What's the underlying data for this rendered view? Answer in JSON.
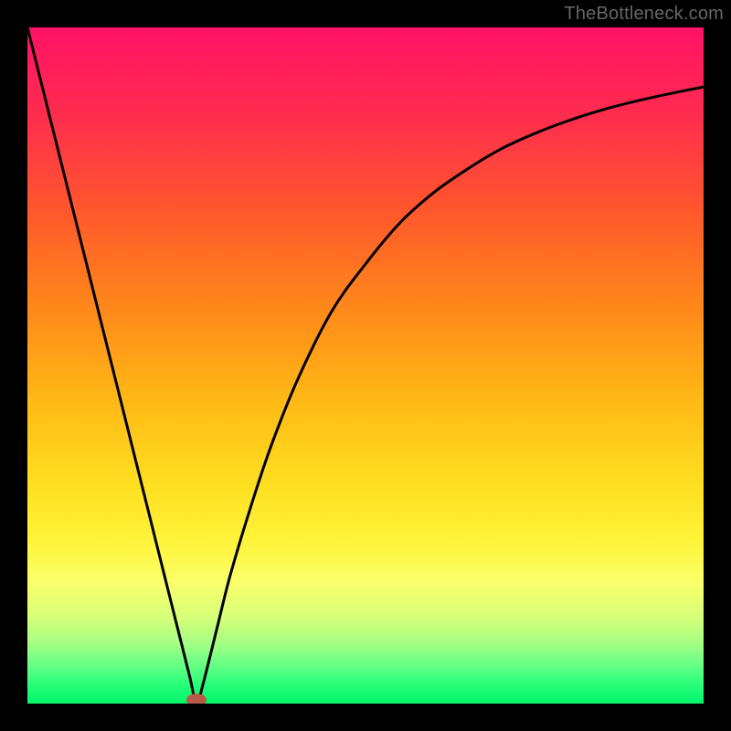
{
  "watermark": {
    "text": "TheBottleneck.com"
  },
  "chart_data": {
    "type": "line",
    "title": "",
    "xlabel": "",
    "ylabel": "",
    "xlim": [
      0,
      100
    ],
    "ylim": [
      0,
      100
    ],
    "grid": false,
    "legend": false,
    "series": [
      {
        "name": "curve",
        "x": [
          0,
          2,
          4,
          6,
          8,
          10,
          12,
          14,
          16,
          18,
          20,
          22,
          24,
          25,
          26,
          28,
          30,
          33,
          36,
          40,
          45,
          50,
          55,
          60,
          65,
          70,
          75,
          80,
          85,
          90,
          95,
          100
        ],
        "y": [
          100,
          92,
          84,
          76,
          68,
          60,
          52,
          44,
          36,
          28,
          20,
          12,
          4,
          0,
          3,
          11,
          19,
          29,
          38,
          48,
          58,
          65,
          71,
          75.5,
          79,
          82,
          84.3,
          86.2,
          87.8,
          89.1,
          90.2,
          91.2
        ]
      }
    ],
    "marker": {
      "x": 25,
      "y": 0,
      "color": "#b85a4a"
    },
    "background_gradient": [
      "#ff1265",
      "#ff2a50",
      "#ff5a2a",
      "#ff8a1a",
      "#ffb815",
      "#ffe022",
      "#fff43a",
      "#fbff6a",
      "#d8ff78",
      "#a6ff83",
      "#6cff86",
      "#2cff7a",
      "#00f56a"
    ]
  }
}
